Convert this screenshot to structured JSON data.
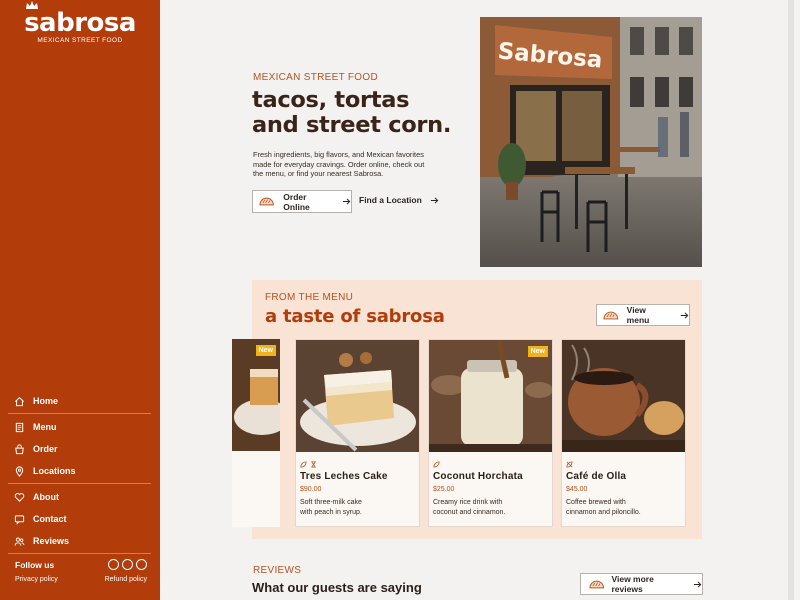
{
  "brand": {
    "name": "sabrosa",
    "tagline": "MEXICAN STREET FOOD",
    "accent": "#b23c0a"
  },
  "sidebar": {
    "items": [
      {
        "label": "Home",
        "icon": "home-icon"
      },
      {
        "label": "Menu",
        "icon": "menu-book-icon"
      },
      {
        "label": "Order",
        "icon": "bag-icon"
      },
      {
        "label": "Locations",
        "icon": "location-pin-icon"
      },
      {
        "label": "About",
        "icon": "heart-hand-icon"
      },
      {
        "label": "Contact",
        "icon": "chat-icon"
      },
      {
        "label": "Reviews",
        "icon": "people-icon"
      }
    ],
    "follow_label": "Follow us",
    "privacy": "Privacy policy",
    "refund": "Refund policy"
  },
  "hero": {
    "eyebrow": "MEXICAN STREET FOOD",
    "title_line1": "tacos, tortas",
    "title_line2": "and street corn.",
    "description": "Fresh ingredients, big flavors, and Mexican favorites made for everyday cravings. Order online, check out the menu, or find your nearest Sabrosa.",
    "order_button": "Order Online",
    "find_link": "Find a Location",
    "sign_text": "Sabrosa"
  },
  "menu_section": {
    "eyebrow": "FROM THE MENU",
    "title": "a taste of sabrosa",
    "view_button": "View menu",
    "cards": [
      {
        "name": "Tres Leches Cake",
        "price": "$90.00",
        "desc_line1": "Soft three-milk cake",
        "desc_line2": "with peach in syrup.",
        "badge": ""
      },
      {
        "name": "Coconut Horchata",
        "price": "$25.00",
        "desc_line1": "Creamy rice drink with",
        "desc_line2": "coconut and cinnamon.",
        "badge": "New"
      },
      {
        "name": "Café de Olla",
        "price": "$45.00",
        "desc_line1": "Coffee brewed with",
        "desc_line2": "cinnamon and piloncillo.",
        "badge": ""
      }
    ],
    "partial_badge": "New"
  },
  "reviews": {
    "eyebrow": "REVIEWS",
    "title": "What our guests are saying",
    "button": "View more reviews"
  }
}
